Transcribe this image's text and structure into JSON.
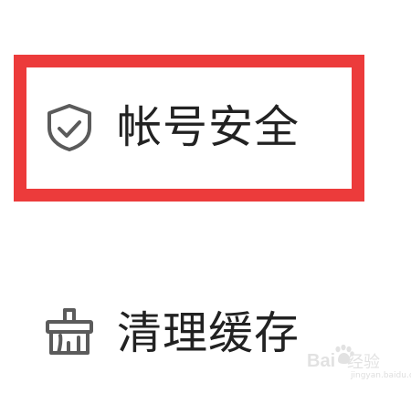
{
  "menu": {
    "items": [
      {
        "label": "帐号安全",
        "icon": "shield-check-icon"
      },
      {
        "label": "清理缓存",
        "icon": "broom-icon"
      }
    ]
  },
  "highlight": {
    "color": "#ec3b3b"
  },
  "watermark": {
    "brand": "Bai",
    "sub": "经验",
    "domain": "jingyan.baidu.com",
    "icon": "paw-icon"
  },
  "colors": {
    "icon": "#5b5b5b",
    "text": "#222222",
    "background": "#ffffff"
  }
}
